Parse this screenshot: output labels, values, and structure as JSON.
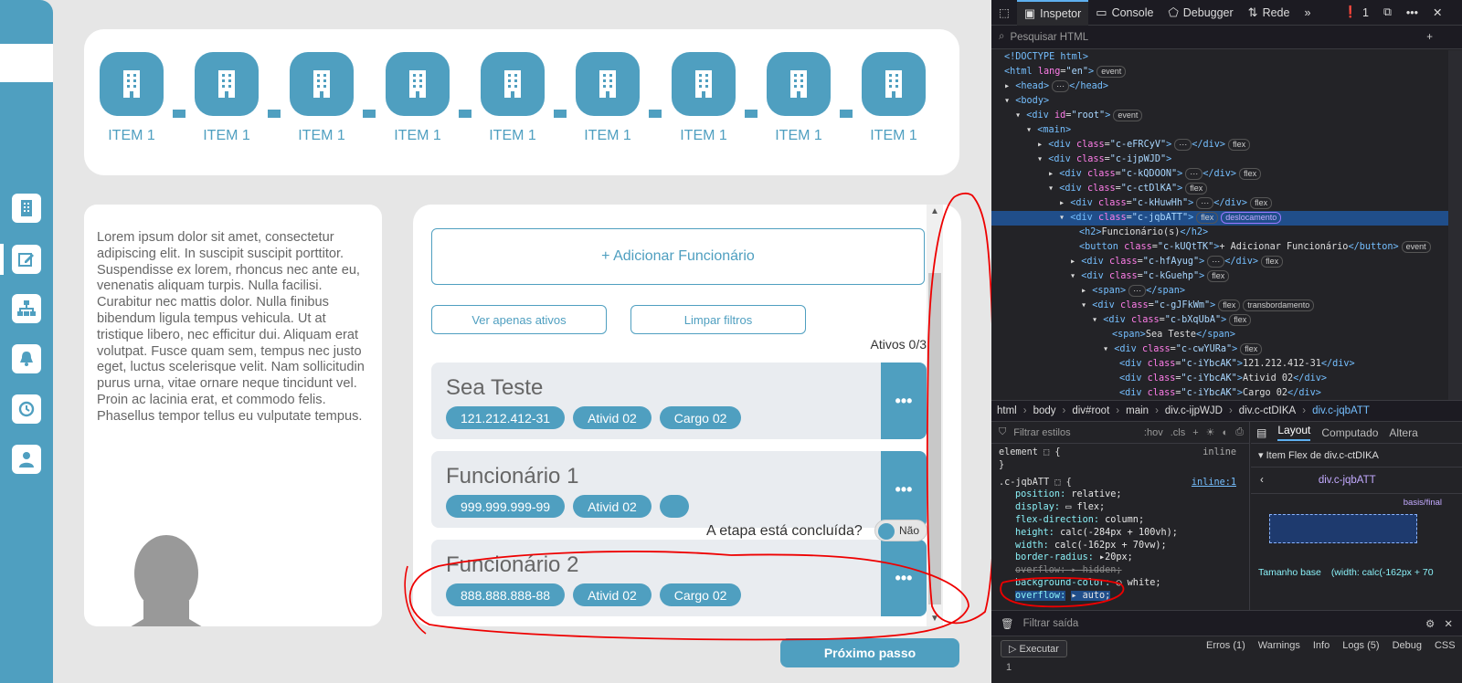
{
  "steps": [
    {
      "label": "ITEM 1"
    },
    {
      "label": "ITEM 1"
    },
    {
      "label": "ITEM 1"
    },
    {
      "label": "ITEM 1"
    },
    {
      "label": "ITEM 1"
    },
    {
      "label": "ITEM 1"
    },
    {
      "label": "ITEM 1"
    },
    {
      "label": "ITEM 1"
    },
    {
      "label": "ITEM 1"
    }
  ],
  "lorem": "Lorem ipsum dolor sit amet, consectetur adipiscing elit. In suscipit suscipit porttitor. Suspendisse ex lorem, rhoncus nec ante eu, venenatis aliquam turpis. Nulla facilisi. Curabitur nec mattis dolor. Nulla finibus bibendum ligula tempus vehicula. Ut at tristique libero, nec efficitur dui. Aliquam erat volutpat. Fusce quam sem, tempus nec justo eget, luctus scelerisque velit. Nam sollicitudin purus urna, vitae ornare neque tincidunt vel. Proin ac lacinia erat, et commodo felis. Phasellus tempor tellus eu vulputate tempus.",
  "panel": {
    "add_button": "+ Adicionar Funcionário",
    "filter_active": "Ver apenas ativos",
    "filter_clear": "Limpar filtros",
    "active_count": "Ativos 0/3"
  },
  "employees": [
    {
      "name": "Sea Teste",
      "id": "121.212.412-31",
      "activity": "Ativid 02",
      "role": "Cargo 02"
    },
    {
      "name": "Funcionário 1",
      "id": "999.999.999-99",
      "activity": "Ativid 02",
      "role": ""
    },
    {
      "name": "Funcionário 2",
      "id": "888.888.888-88",
      "activity": "Ativid 02",
      "role": "Cargo 02"
    }
  ],
  "more_label": "•••",
  "stage_question": "A etapa está concluída?",
  "toggle_label": "Não",
  "next_button": "Próximo passo",
  "devtools": {
    "tabs": [
      "Inspetor",
      "Console",
      "Debugger",
      "Rede"
    ],
    "error_count": "1",
    "search_placeholder": "Pesquisar HTML",
    "breadcrumbs": [
      "html",
      "body",
      "div#root",
      "main",
      "div.c-ijpWJD",
      "div.c-ctDIKA",
      "div.c-jqbATT"
    ],
    "filter_styles": "Filtrar estilos",
    "hov": ":hov",
    "cls": ".cls",
    "layout_tabs": [
      "Layout",
      "Computado",
      "Altera"
    ],
    "flex_item_of": "Item Flex de div.c-ctDIKA",
    "flex_selector": "div.c-jqbATT",
    "basis_final": "basis/final",
    "base_size": "Tamanho base",
    "base_size_value": "(width: calc(-162px + 70",
    "run": "Executar",
    "filter_output": "Filtrar saída",
    "log_levels": [
      "Erros (1)",
      "Warnings",
      "Info",
      "Logs (5)",
      "Debug",
      "CSS"
    ],
    "line_number": "1"
  }
}
